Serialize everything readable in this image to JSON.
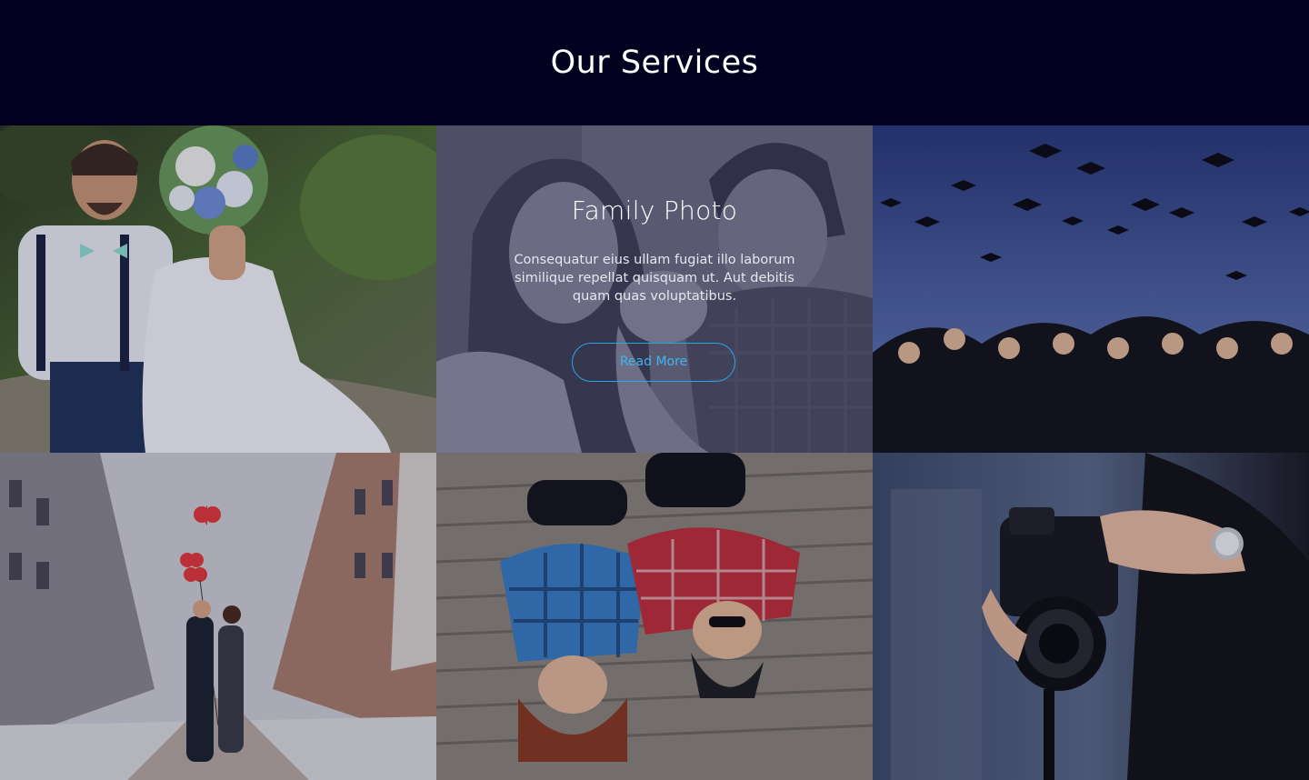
{
  "section": {
    "title": "Our Services"
  },
  "tiles": [
    {
      "image": "wedding-couple-with-bouquet"
    },
    {
      "image": "family-kissing-baby",
      "title": "Family Photo",
      "description": "Consequatur eius ullam fugiat illo laborum similique repellat quisquam ut. Aut debitis quam quas  voluptatibus.",
      "button_label": "Read More"
    },
    {
      "image": "graduates-throwing-caps"
    },
    {
      "image": "couple-kissing-with-red-heart-balloons"
    },
    {
      "image": "two-girls-lying-on-boardwalk"
    },
    {
      "image": "hands-holding-dslr-camera"
    }
  ],
  "colors": {
    "background": "#02001f",
    "accent": "#26a6e3",
    "title_text": "#ffffff"
  }
}
